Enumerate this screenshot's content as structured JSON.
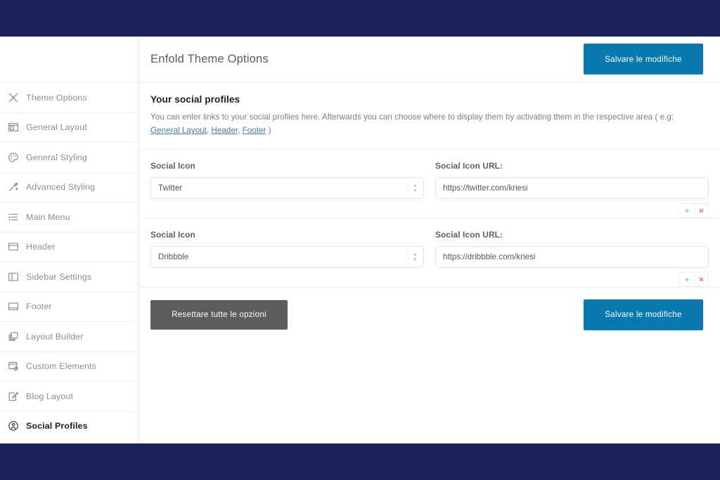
{
  "colors": {
    "chrome_navy": "#1b2257",
    "accent_blue": "#0a79ae",
    "reset_gray": "#5d5d5d",
    "add_green": "#7ebb4e",
    "delete_red": "#c94a32",
    "link_blue": "#4a7b9d"
  },
  "header": {
    "title": "Enfold Theme Options",
    "save_label": "Salvare le modifiche"
  },
  "sidebar": {
    "items": [
      {
        "label": "Theme Options",
        "icon": "tools-icon",
        "active": false
      },
      {
        "label": "General Layout",
        "icon": "layout-icon",
        "active": false
      },
      {
        "label": "General Styling",
        "icon": "palette-icon",
        "active": false
      },
      {
        "label": "Advanced Styling",
        "icon": "magic-wand-icon",
        "active": false
      },
      {
        "label": "Main Menu",
        "icon": "list-icon",
        "active": false
      },
      {
        "label": "Header",
        "icon": "header-box-icon",
        "active": false
      },
      {
        "label": "Sidebar Settings",
        "icon": "sidebar-columns-icon",
        "active": false
      },
      {
        "label": "Footer",
        "icon": "footer-box-icon",
        "active": false
      },
      {
        "label": "Layout Builder",
        "icon": "stacked-layers-icon",
        "active": false
      },
      {
        "label": "Custom Elements",
        "icon": "custom-element-icon",
        "active": false
      },
      {
        "label": "Blog Layout",
        "icon": "pencil-page-icon",
        "active": false
      },
      {
        "label": "Social Profiles",
        "icon": "social-circle-icon",
        "active": true
      }
    ]
  },
  "section": {
    "title": "Your social profiles",
    "description_part1": "You can enter links to your social profiles here. Afterwards you can choose where to display them by activating them in the respective area ( e.g: ",
    "link_general_layout": "General Layout",
    "desc_sep1": ", ",
    "link_header": "Header",
    "desc_sep2": ", ",
    "link_footer": "Footer",
    "description_part2": " )"
  },
  "form": {
    "icon_label": "Social Icon",
    "url_label": "Social Icon URL:",
    "add_label": "+",
    "delete_label": "×",
    "rows": [
      {
        "icon_value": "Twitter",
        "url_value": "https://twitter.com/kriesi"
      },
      {
        "icon_value": "Dribbble",
        "url_value": "https://dribbble.com/kriesi"
      }
    ]
  },
  "footer": {
    "reset_label": "Resettare tutte le opzioni",
    "save_label": "Salvare le modifiche"
  }
}
